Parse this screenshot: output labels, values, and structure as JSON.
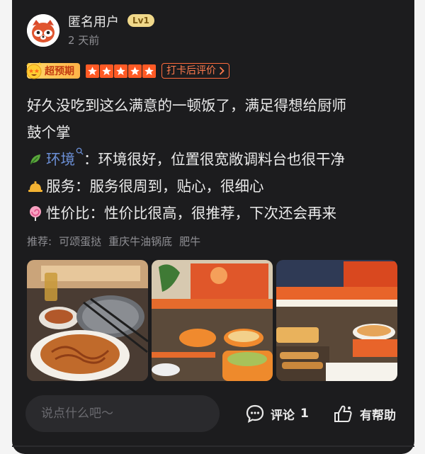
{
  "user": {
    "name": "匿名用户",
    "level": "Lv1",
    "time_ago": "2 天前",
    "avatar_icon": "red-panda-avatar"
  },
  "rating": {
    "badge_label": "超预期",
    "badge_icon": "star-struck-face-icon",
    "stars": 5,
    "stars_max": 5,
    "checkin_label": "打卡后评价",
    "accent": "#ff5a25"
  },
  "review": {
    "line1": "好久没吃到这么满意的一顿饭了，满足得想给厨师",
    "line2": "鼓个掌",
    "env_label": "环境",
    "env_text": "：环境很好，位置很宽敞调料台也很干净",
    "service_text": "服务：服务很周到，贴心，很细心",
    "value_text": "性价比：性价比很高，很推荐，下次还会再来"
  },
  "recommend": {
    "label": "推荐:",
    "items": [
      "可颂蛋挞",
      "重庆牛油锅底",
      "肥牛"
    ]
  },
  "photos": [
    "food-photo-noodles",
    "food-photo-conveyor-1",
    "food-photo-conveyor-2"
  ],
  "bottom_bar": {
    "comment_placeholder": "说点什么吧～",
    "comment_label": "评论",
    "comment_count": "1",
    "helpful_label": "有帮助"
  }
}
